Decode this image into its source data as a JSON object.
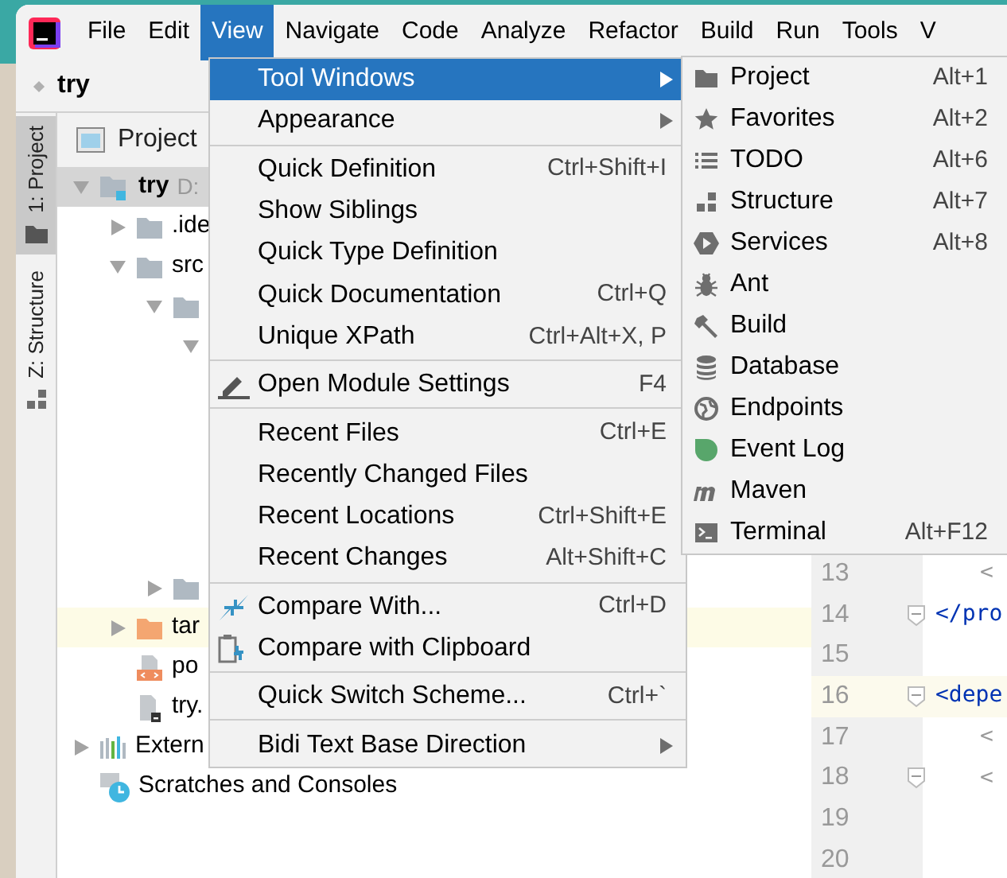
{
  "menubar": [
    {
      "label": "File",
      "selected": false
    },
    {
      "label": "Edit",
      "selected": false
    },
    {
      "label": "View",
      "selected": true
    },
    {
      "label": "Navigate",
      "selected": false
    },
    {
      "label": "Code",
      "selected": false
    },
    {
      "label": "Analyze",
      "selected": false
    },
    {
      "label": "Refactor",
      "selected": false
    },
    {
      "label": "Build",
      "selected": false
    },
    {
      "label": "Run",
      "selected": false
    },
    {
      "label": "Tools",
      "selected": false
    },
    {
      "label": "V",
      "selected": false
    }
  ],
  "breadcrumb": "try",
  "tool_stripe": [
    {
      "label": "1: Project",
      "selected": true
    },
    {
      "label": "Z: Structure",
      "selected": false
    }
  ],
  "project_panel": {
    "title": "Project",
    "tree": [
      {
        "label": "try",
        "detail": "D:",
        "kind": "module",
        "expanded": true,
        "highlighted": false,
        "children": [
          {
            "label": ".ide",
            "kind": "folder",
            "expanded": false,
            "highlighted": false
          },
          {
            "label": "src",
            "kind": "folder",
            "expanded": true,
            "highlighted": false,
            "children": [
              {
                "kind": "folder",
                "expanded": true,
                "highlighted": false,
                "children": [
                  {
                    "expanded": true,
                    "highlighted": false
                  }
                ]
              },
              {
                "kind": "folder",
                "expanded": false,
                "highlighted": false
              }
            ]
          },
          {
            "label": "tar",
            "kind": "excluded",
            "expanded": false,
            "highlighted": true
          },
          {
            "label": "po",
            "kind": "xml",
            "highlighted": false
          },
          {
            "label": "try.",
            "kind": "iml",
            "highlighted": false
          }
        ]
      },
      {
        "label": "Extern",
        "kind": "libraries",
        "expanded": false,
        "highlighted": false
      },
      {
        "label": "Scratches and Consoles",
        "kind": "scratches",
        "highlighted": false
      }
    ]
  },
  "editor": {
    "lines": [
      {
        "number": "13",
        "code": "<",
        "indent": true,
        "fold": false,
        "current": false
      },
      {
        "number": "14",
        "code": "</pro",
        "indent": false,
        "fold": true,
        "current": false
      },
      {
        "number": "15",
        "fold": false,
        "current": false
      },
      {
        "number": "16",
        "code": "<depe",
        "indent": false,
        "fold": true,
        "current": true
      },
      {
        "number": "17",
        "code": "<",
        "indent": true,
        "fold": false,
        "current": false
      },
      {
        "number": "18",
        "code": "<",
        "indent": true,
        "fold": true,
        "current": false
      },
      {
        "number": "19",
        "fold": false,
        "current": false
      },
      {
        "number": "20",
        "fold": false,
        "current": false
      }
    ]
  },
  "view_menu": [
    {
      "kind": "item",
      "label": "Tool Windows",
      "submenu": true,
      "selected": true
    },
    {
      "kind": "item",
      "label": "Appearance",
      "submenu": true,
      "selected": false
    },
    {
      "kind": "separator"
    },
    {
      "kind": "item",
      "label": "Quick Definition",
      "shortcut": "Ctrl+Shift+I",
      "selected": false
    },
    {
      "kind": "item",
      "label": "Show Siblings",
      "selected": false
    },
    {
      "kind": "item",
      "label": "Quick Type Definition",
      "selected": false
    },
    {
      "kind": "item",
      "label": "Quick Documentation",
      "shortcut": "Ctrl+Q",
      "selected": false
    },
    {
      "kind": "item",
      "label": "Unique XPath",
      "shortcut": "Ctrl+Alt+X, P",
      "selected": false
    },
    {
      "kind": "separator"
    },
    {
      "kind": "item",
      "label": "Open Module Settings",
      "shortcut": "F4",
      "selected": false
    },
    {
      "kind": "separator"
    },
    {
      "kind": "item",
      "label": "Recent Files",
      "shortcut": "Ctrl+E",
      "selected": false
    },
    {
      "kind": "item",
      "label": "Recently Changed Files",
      "selected": false
    },
    {
      "kind": "item",
      "label": "Recent Locations",
      "shortcut": "Ctrl+Shift+E",
      "selected": false
    },
    {
      "kind": "item",
      "label": "Recent Changes",
      "shortcut": "Alt+Shift+C",
      "selected": false
    },
    {
      "kind": "separator"
    },
    {
      "kind": "item",
      "label": "Compare With...",
      "shortcut": "Ctrl+D",
      "selected": false
    },
    {
      "kind": "item",
      "label": "Compare with Clipboard",
      "selected": false
    },
    {
      "kind": "separator"
    },
    {
      "kind": "item",
      "label": "Quick Switch Scheme...",
      "shortcut": "Ctrl+`",
      "selected": false
    },
    {
      "kind": "separator"
    },
    {
      "kind": "item",
      "label": "Bidi Text Base Direction",
      "submenu": true,
      "selected": false
    }
  ],
  "tool_windows_menu": [
    {
      "label": "Project",
      "shortcut": "Alt+1"
    },
    {
      "label": "Favorites",
      "shortcut": "Alt+2"
    },
    {
      "label": "TODO",
      "shortcut": "Alt+6"
    },
    {
      "label": "Structure",
      "shortcut": "Alt+7"
    },
    {
      "label": "Services",
      "shortcut": "Alt+8"
    },
    {
      "label": "Ant"
    },
    {
      "label": "Build"
    },
    {
      "label": "Database"
    },
    {
      "label": "Endpoints"
    },
    {
      "label": "Event Log"
    },
    {
      "label": "Maven"
    },
    {
      "label": "Terminal",
      "shortcut": "Alt+F12"
    }
  ]
}
